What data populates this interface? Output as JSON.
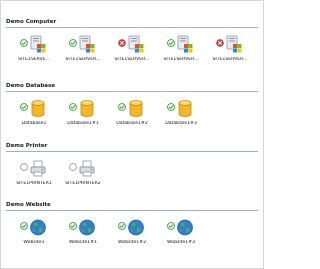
{
  "groups": [
    {
      "title": "Demo Computer",
      "items": [
        {
          "label": "SITE1SERVE...",
          "status": "ok",
          "icon": "computer-icon"
        },
        {
          "label": "SITE1SERVER...",
          "status": "ok",
          "icon": "computer-icon"
        },
        {
          "label": "SITE1SERVER...",
          "status": "error",
          "icon": "computer-icon"
        },
        {
          "label": "SITE1SERVER...",
          "status": "ok",
          "icon": "computer-icon"
        },
        {
          "label": "SITE1SERVER...",
          "status": "error",
          "icon": "computer-icon"
        }
      ]
    },
    {
      "title": "Demo Database",
      "items": [
        {
          "label": "Database1",
          "status": "ok",
          "icon": "database-icon"
        },
        {
          "label": "Database1#1",
          "status": "ok",
          "icon": "database-icon"
        },
        {
          "label": "Database1#2",
          "status": "ok",
          "icon": "database-icon"
        },
        {
          "label": "Database1#3",
          "status": "ok",
          "icon": "database-icon"
        }
      ]
    },
    {
      "title": "Demo Printer",
      "items": [
        {
          "label": "SITE1PRINTER1",
          "status": "pending",
          "icon": "printer-icon"
        },
        {
          "label": "SITE1PRINTER2",
          "status": "pending",
          "icon": "printer-icon"
        }
      ]
    },
    {
      "title": "Demo Website",
      "items": [
        {
          "label": "Website1",
          "status": "ok",
          "icon": "globe-icon"
        },
        {
          "label": "Website1#1",
          "status": "ok",
          "icon": "globe-icon"
        },
        {
          "label": "Website1#2",
          "status": "ok",
          "icon": "globe-icon"
        },
        {
          "label": "Website1#3",
          "status": "ok",
          "icon": "globe-icon"
        }
      ]
    }
  ],
  "colors": {
    "ok": "#3aa63a",
    "error": "#d93a3a",
    "pending": "#9a9a9a",
    "rule": "#9ab1d4"
  }
}
